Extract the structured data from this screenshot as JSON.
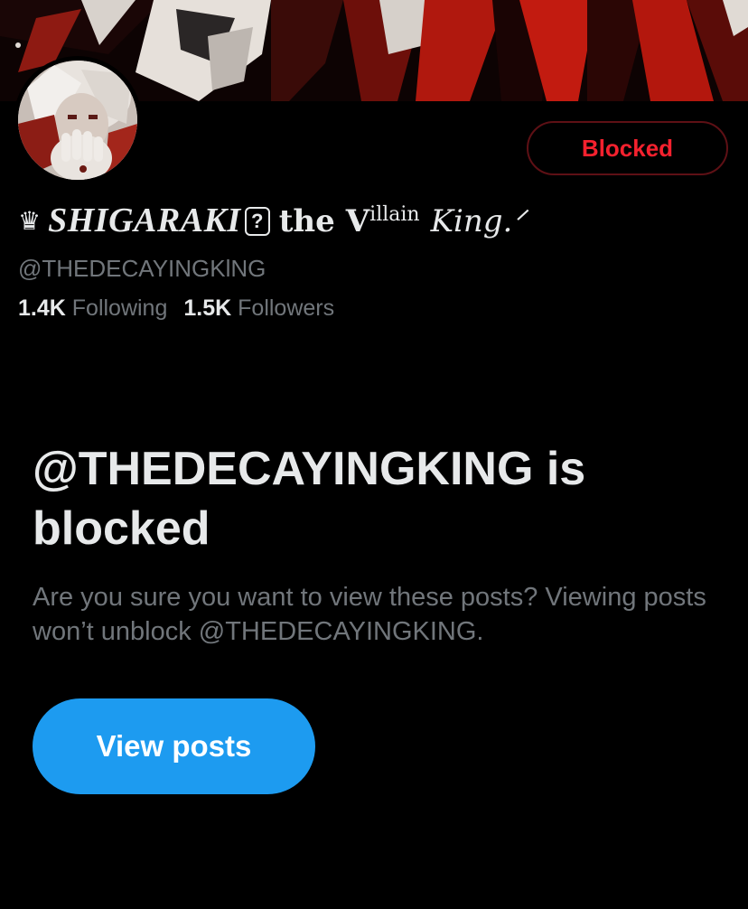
{
  "profile": {
    "display_name": {
      "crown": "♛",
      "main": "SHIGARAKI",
      "emoji_placeholder": "?",
      "the": "the",
      "villain_v": "V",
      "villain_rest": "illain",
      "king": "King.ᐟ"
    },
    "handle": "@THEDECAYINGKlNG",
    "following_count": "1.4K",
    "following_label": "Following",
    "followers_count": "1.5K",
    "followers_label": "Followers",
    "blocked_button_label": "Blocked"
  },
  "blocked_notice": {
    "headline": "@THEDECAYINGKING is blocked",
    "body": "Are you sure you want to view these posts? Viewing posts won’t unblock @THEDECAYINGKING.",
    "view_posts_label": "View posts"
  },
  "colors": {
    "background": "#000000",
    "primary_text": "#e7e9ea",
    "secondary_text": "#71767b",
    "accent_blue": "#1d9bf0",
    "blocked_red": "#f4212e",
    "blocked_border": "#5e1015",
    "banner_red": "#b0180e"
  }
}
